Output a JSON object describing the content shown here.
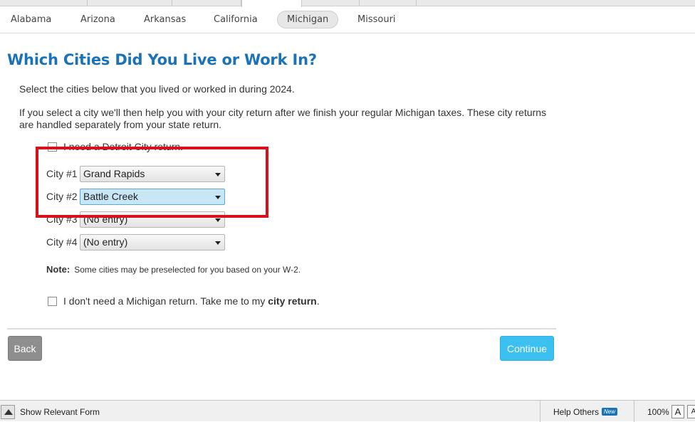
{
  "states": {
    "tabs": [
      "Alabama",
      "Arizona",
      "Arkansas",
      "California",
      "Michigan",
      "Missouri"
    ],
    "active": "Michigan"
  },
  "page_title": "Which Cities Did You Live or Work In?",
  "intro": "Select the cities below that you lived or worked in during 2024.",
  "explain": "If you select a city we'll then help you with your city return after we finish your regular Michigan taxes. These city returns are handled separately from your state return.",
  "detroit_checkbox": {
    "label": "I need a Detroit City return.",
    "checked": false
  },
  "cities": [
    {
      "label": "City #1",
      "value": "Grand Rapids"
    },
    {
      "label": "City #2",
      "value": "Battle Creek"
    },
    {
      "label": "City #3",
      "value": "(No entry)"
    },
    {
      "label": "City #4",
      "value": "(No entry)"
    }
  ],
  "note": {
    "label": "Note:",
    "text": "Some cities may be preselected for you based on your W-2."
  },
  "skip_checkbox": {
    "label_prefix": "I don't need a Michigan return. Take me to my ",
    "label_bold": "city return",
    "label_suffix": ".",
    "checked": false
  },
  "buttons": {
    "back": "Back",
    "continue": "Continue"
  },
  "bottom_bar": {
    "show_form": "Show Relevant Form",
    "help_others": "Help Others",
    "new_badge": "New",
    "zoom": "100%",
    "font_large": "A",
    "font_small": "A"
  },
  "colors": {
    "title": "#1a73b8",
    "continue": "#3cc0f0",
    "back": "#8e8e8e",
    "highlight": "#d9101a"
  }
}
